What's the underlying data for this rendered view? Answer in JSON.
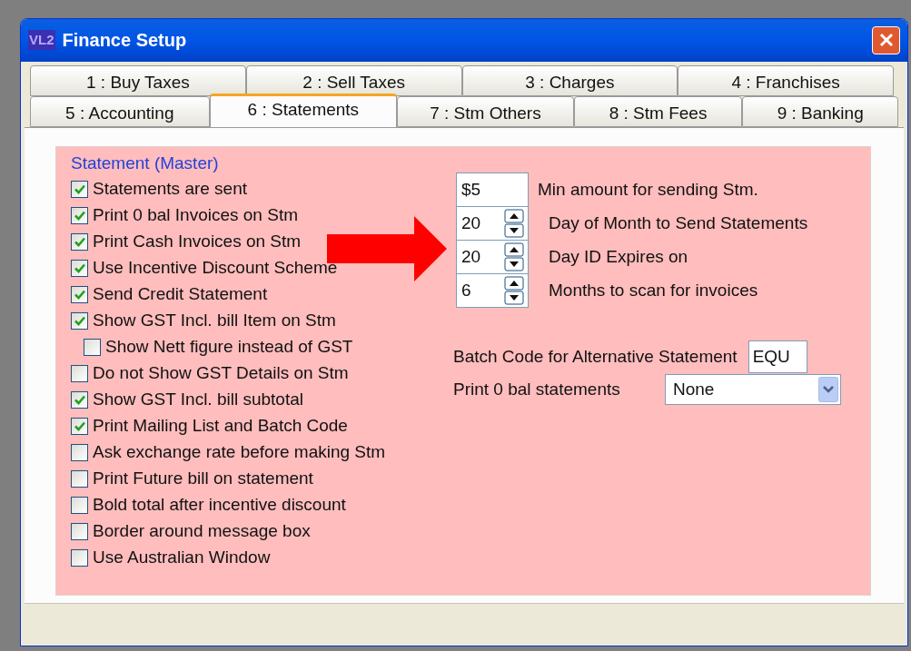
{
  "window": {
    "icon_text": "VL2",
    "title": "Finance Setup"
  },
  "tab_rows": [
    [
      {
        "label": "1 : Buy Taxes",
        "selected": false
      },
      {
        "label": "2 : Sell Taxes",
        "selected": false
      },
      {
        "label": "3 : Charges",
        "selected": false
      },
      {
        "label": "4 : Franchises",
        "selected": false
      }
    ],
    [
      {
        "label": "5 : Accounting",
        "selected": false
      },
      {
        "label": "6 : Statements",
        "selected": true
      },
      {
        "label": "7 : Stm Others",
        "selected": false
      },
      {
        "label": "8 : Stm Fees",
        "selected": false
      },
      {
        "label": "9 : Banking",
        "selected": false
      }
    ]
  ],
  "group": {
    "title": "Statement (Master)",
    "checkboxes": [
      {
        "label": "Statements are sent",
        "checked": true
      },
      {
        "label": "Print 0 bal Invoices on Stm",
        "checked": true
      },
      {
        "label": "Print Cash Invoices on Stm",
        "checked": true
      },
      {
        "label": "Use Incentive Discount Scheme",
        "checked": true
      },
      {
        "label": "Send Credit Statement",
        "checked": true
      },
      {
        "label": "Show GST Incl. bill Item on Stm",
        "checked": true,
        "children": [
          {
            "label": "Show Nett figure instead of GST",
            "checked": false
          }
        ]
      },
      {
        "label": "Do not Show GST Details on Stm",
        "checked": false
      },
      {
        "label": "Show GST Incl. bill subtotal",
        "checked": true
      },
      {
        "label": "Print Mailing List and Batch Code",
        "checked": true
      },
      {
        "label": "Ask exchange rate before making Stm",
        "checked": false
      },
      {
        "label": "Print Future bill on statement",
        "checked": false
      },
      {
        "label": "Bold total after incentive discount",
        "checked": false
      },
      {
        "label": "Border around message box",
        "checked": false
      },
      {
        "label": "Use Australian Window",
        "checked": false
      }
    ],
    "fields": [
      {
        "kind": "text",
        "value": "$5",
        "label": "Min amount for sending Stm."
      },
      {
        "kind": "spinner",
        "value": "20",
        "label": "Day of Month to Send Statements"
      },
      {
        "kind": "spinner",
        "value": "20",
        "label": "Day ID Expires on"
      },
      {
        "kind": "spinner",
        "value": "6",
        "label": "Months to scan for invoices"
      }
    ],
    "batch_code": {
      "label": "Batch Code for Alternative Statement",
      "value": "EQU"
    },
    "print_zero_bal": {
      "label": "Print 0 bal statements",
      "value": "None"
    }
  }
}
